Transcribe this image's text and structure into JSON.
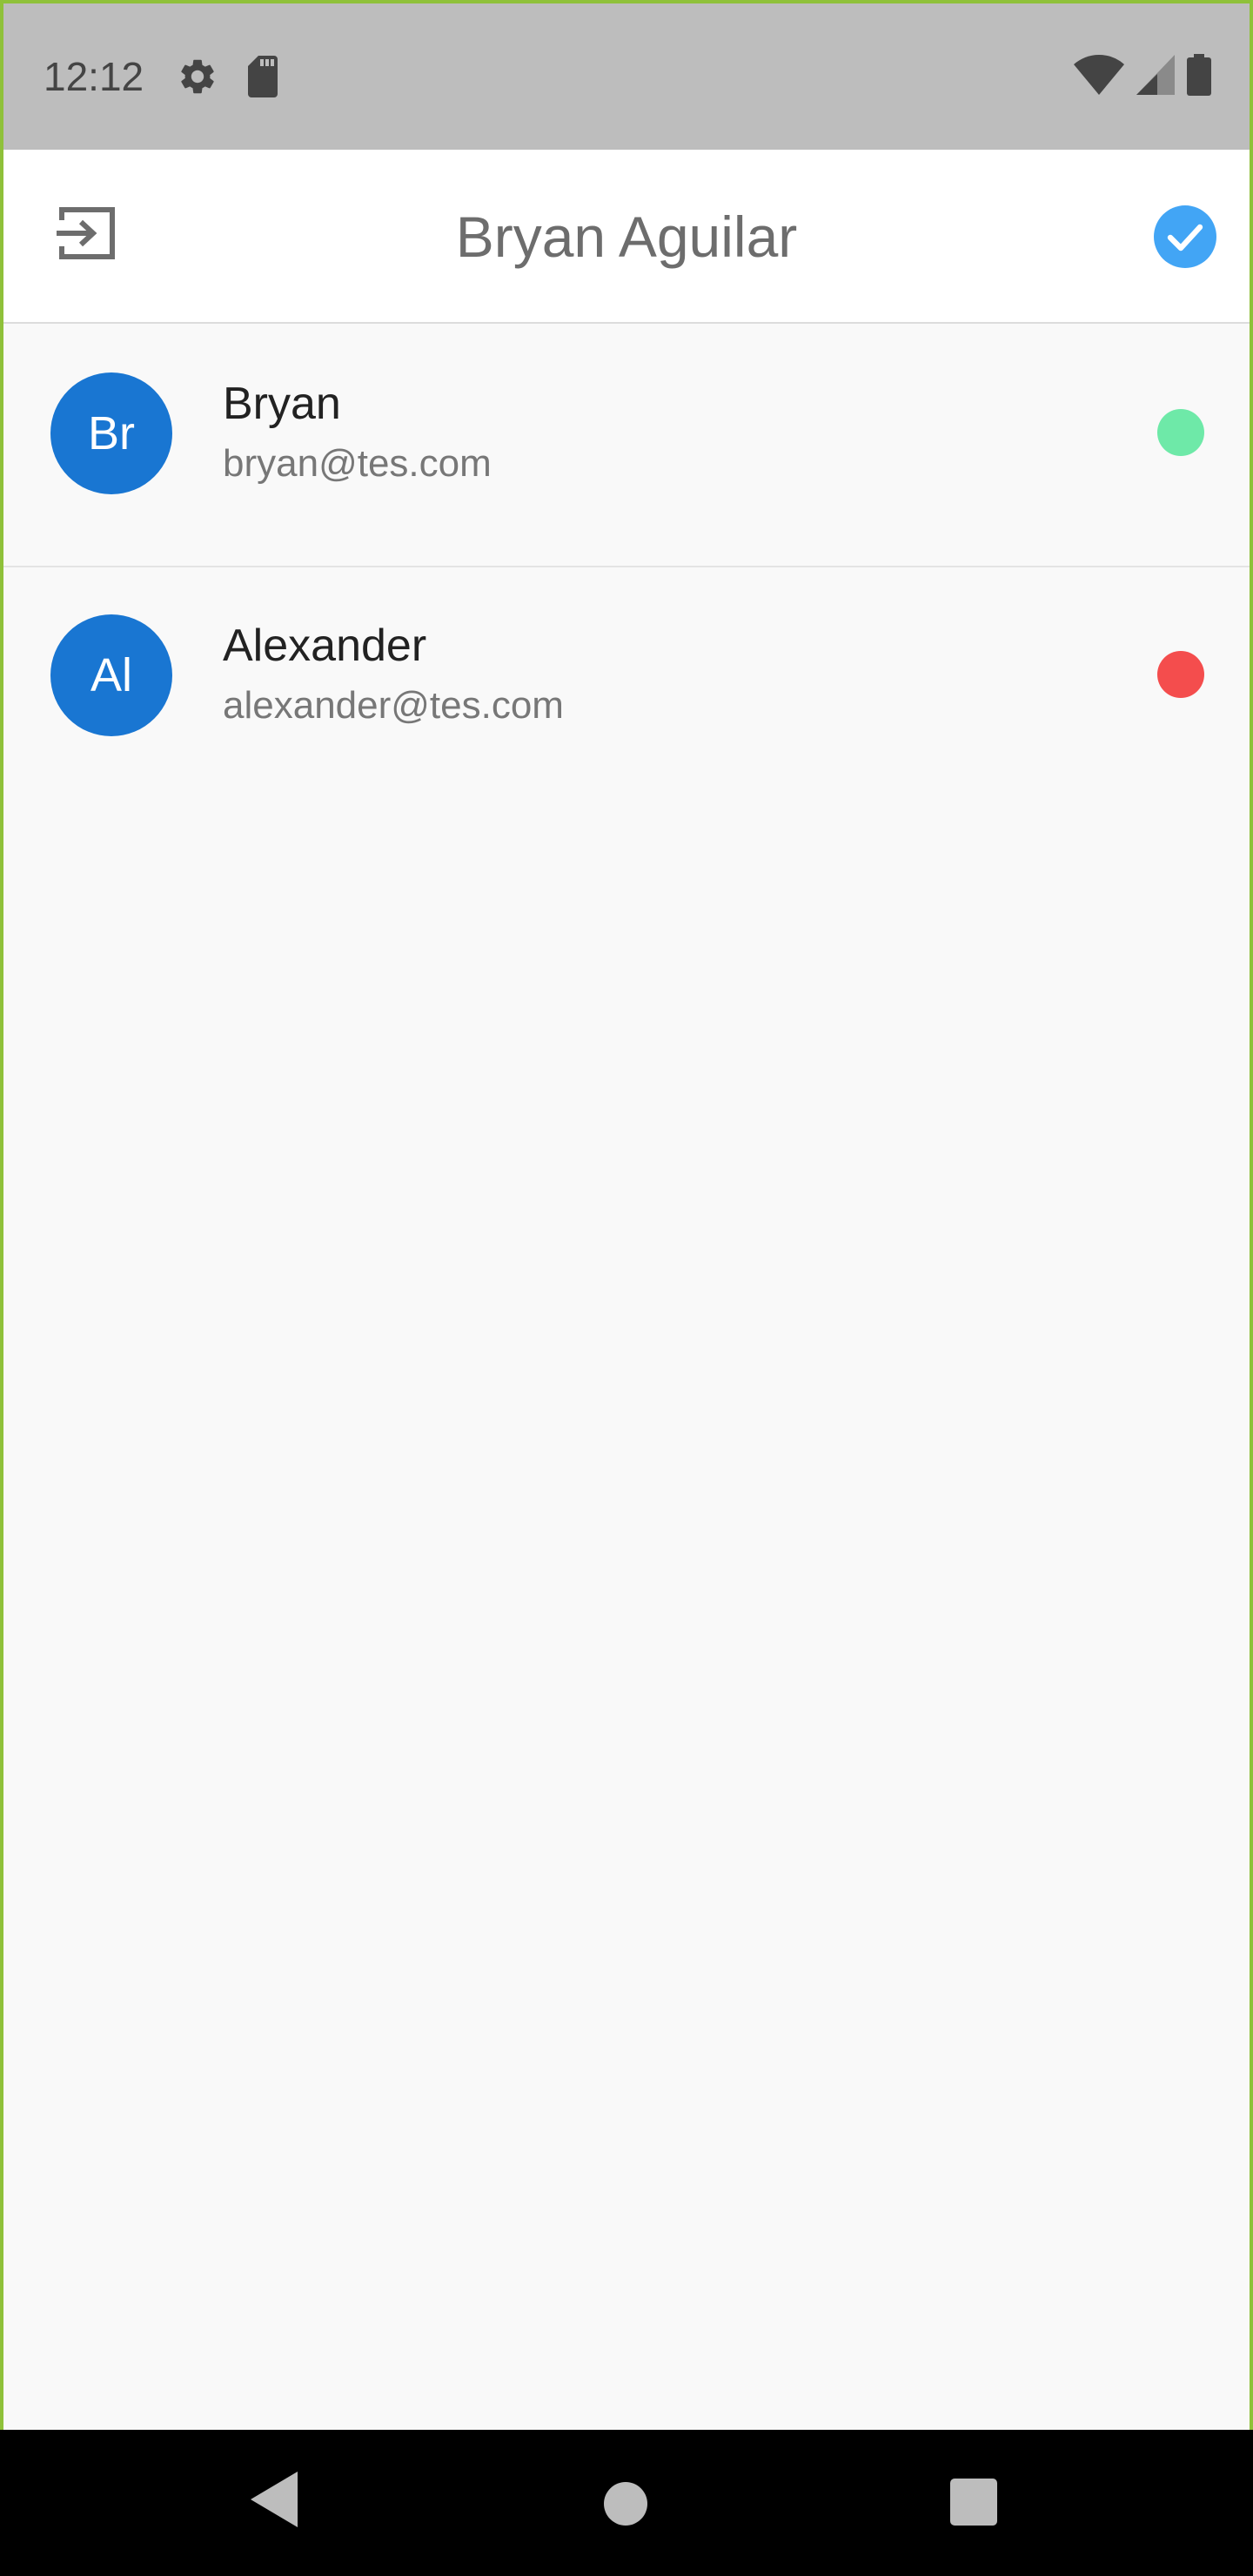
{
  "status_bar": {
    "time": "12:12",
    "icons": [
      "gear-icon",
      "sd-card-icon",
      "wifi-icon",
      "signal-icon",
      "battery-icon"
    ]
  },
  "app_bar": {
    "title": "Bryan Aguilar",
    "left_icon": "exit-icon",
    "right_icon": "check-circle-icon"
  },
  "colors": {
    "accent": "#1976d2",
    "online": "#6ee9a8",
    "offline": "#f44d4d",
    "check": "#42a5f5"
  },
  "users": [
    {
      "initials": "Br",
      "name": "Bryan",
      "email": "bryan@tes.com",
      "status": "online"
    },
    {
      "initials": "Al",
      "name": "Alexander",
      "email": "alexander@tes.com",
      "status": "offline"
    }
  ],
  "nav_bar": {
    "icons": [
      "back-icon",
      "home-icon",
      "recents-icon"
    ]
  }
}
